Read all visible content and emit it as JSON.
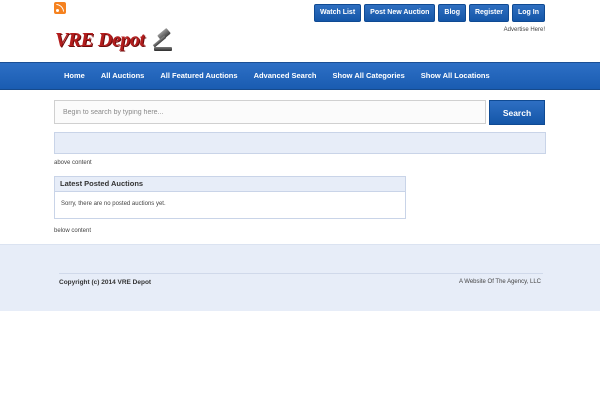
{
  "header": {
    "logo_text": "VRE Depot",
    "top_links": [
      "Watch List",
      "Post New Auction",
      "Blog",
      "Register",
      "Log In"
    ],
    "advertise": "Advertise Here!"
  },
  "nav": {
    "items": [
      "Home",
      "All Auctions",
      "All Featured Auctions",
      "Advanced Search",
      "Show All Categories",
      "Show All Locations"
    ]
  },
  "search": {
    "placeholder": "Begin to search by typing here...",
    "button_label": "Search"
  },
  "content": {
    "above_text": "above content",
    "panel_title": "Latest Posted Auctions",
    "panel_message": "Sorry, there are no posted auctions yet.",
    "below_text": "below content"
  },
  "footer": {
    "copyright": "Copyright (c) 2014 VRE Depot",
    "credit": "A Website Of The Agency, LLC"
  }
}
